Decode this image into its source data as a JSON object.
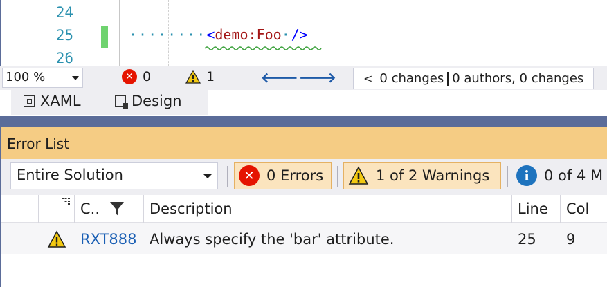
{
  "editor": {
    "line_numbers": [
      "24",
      "25",
      "26"
    ],
    "code": {
      "indent_dots": "········",
      "open_bracket": "<",
      "tag_name": "demo:Foo",
      "dot_separator": "·",
      "close_bracket": "/>"
    }
  },
  "status_bar": {
    "zoom": "100 %",
    "error_count": "0",
    "warning_count": "1",
    "changes_text": "0 changes",
    "authors_text": "0 authors, 0 changes"
  },
  "view_tabs": [
    {
      "label": "XAML"
    },
    {
      "label": "Design"
    }
  ],
  "error_list": {
    "title": "Error List",
    "scope": "Entire Solution",
    "errors_label": "0 Errors",
    "warnings_label": "1 of 2 Warnings",
    "messages_label": "0 of 4 M",
    "columns": {
      "code": "C..",
      "description": "Description",
      "line": "Line",
      "col": "Col"
    },
    "rows": [
      {
        "severity": "warning",
        "code": "RXT888",
        "description": "Always specify the 'bar' attribute.",
        "line": "25",
        "col": "9"
      }
    ]
  },
  "colors": {
    "accent_blue": "#5b6c99",
    "panel_title": "#f5cc84",
    "error_red": "#e51400",
    "warning_yellow": "#f2c811",
    "info_blue": "#1e73be",
    "change_green": "#6fd36f"
  },
  "icons": [
    "error-icon",
    "warning-icon",
    "info-icon",
    "filter-icon",
    "back-arrow-icon",
    "forward-arrow-icon",
    "xaml-icon",
    "design-icon"
  ]
}
